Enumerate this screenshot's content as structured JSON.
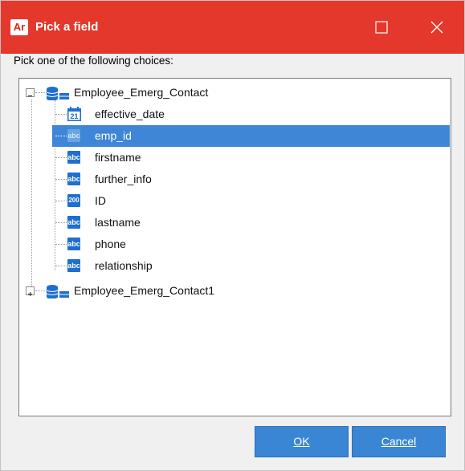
{
  "window": {
    "app_icon_text": "Ar",
    "title": "Pick a field"
  },
  "instruction": "Pick one of the following choices:",
  "tree": {
    "groups": [
      {
        "name": "Employee_Emerg_Contact",
        "expanded": true,
        "fields": [
          {
            "name": "effective_date",
            "type": "date",
            "badge": "21"
          },
          {
            "name": "emp_id",
            "type": "string",
            "badge": "abc",
            "selected": true
          },
          {
            "name": "firstname",
            "type": "string",
            "badge": "abc"
          },
          {
            "name": "further_info",
            "type": "string",
            "badge": "abc"
          },
          {
            "name": "ID",
            "type": "number",
            "badge": "200"
          },
          {
            "name": "lastname",
            "type": "string",
            "badge": "abc"
          },
          {
            "name": "phone",
            "type": "string",
            "badge": "abc"
          },
          {
            "name": "relationship",
            "type": "string",
            "badge": "abc"
          }
        ]
      },
      {
        "name": "Employee_Emerg_Contact1",
        "expanded": false,
        "fields": []
      }
    ]
  },
  "buttons": {
    "ok_label": "OK",
    "cancel_label": "Cancel"
  },
  "colors": {
    "titlebar": "#e4382c",
    "selection": "#3f86d6",
    "button": "#3b86d4",
    "type_badge": "#1e6fd0"
  }
}
